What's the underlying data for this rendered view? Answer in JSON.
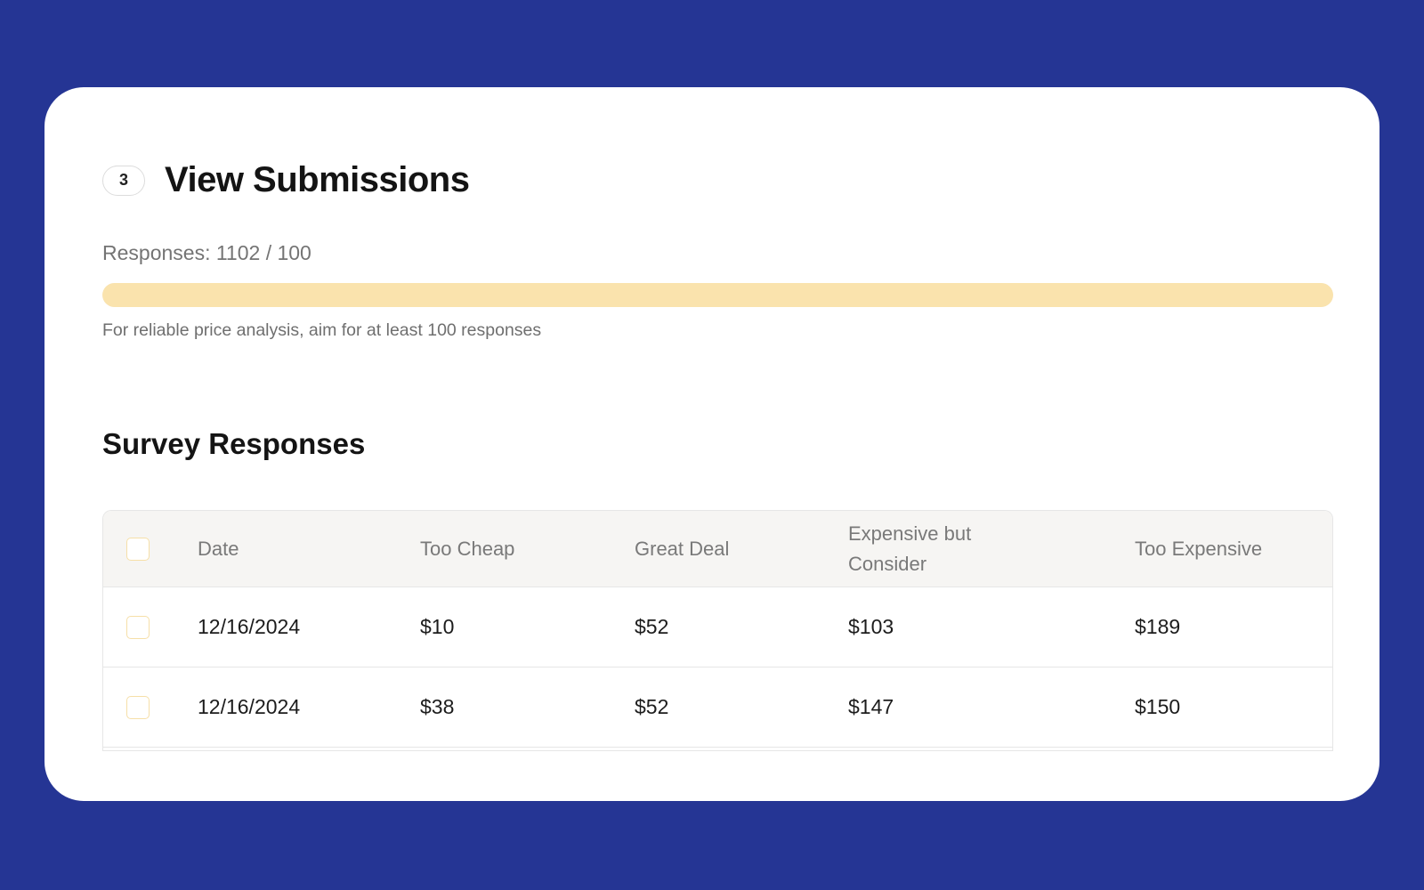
{
  "step": {
    "number": "3",
    "title": "View Submissions"
  },
  "responses": {
    "label": "Responses: 1102 / 100",
    "progress_fraction": 1.0,
    "hint": "For reliable price analysis, aim for at least 100 responses"
  },
  "colors": {
    "background": "#253594",
    "progress_fill": "#fae3ad",
    "checkbox_border": "#f6dfa8"
  },
  "survey": {
    "title": "Survey Responses",
    "columns": {
      "date": "Date",
      "too_cheap": "Too Cheap",
      "great_deal": "Great Deal",
      "expensive_but_consider": "Expensive but Consider",
      "too_expensive": "Too Expensive"
    },
    "rows": [
      {
        "date": "12/16/2024",
        "too_cheap": "$10",
        "great_deal": "$52",
        "expensive_but_consider": "$103",
        "too_expensive": "$189"
      },
      {
        "date": "12/16/2024",
        "too_cheap": "$38",
        "great_deal": "$52",
        "expensive_but_consider": "$147",
        "too_expensive": "$150"
      }
    ]
  }
}
